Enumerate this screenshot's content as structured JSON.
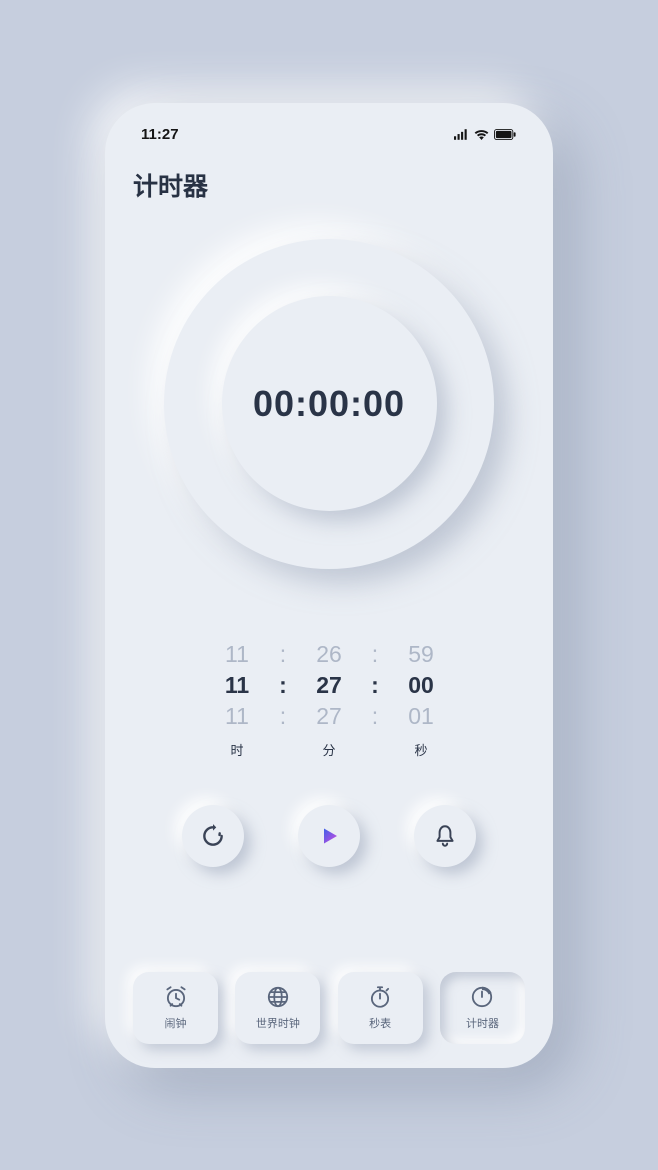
{
  "status_bar": {
    "time": "11:27"
  },
  "page": {
    "title": "计时器"
  },
  "timer": {
    "display": "00:00:00"
  },
  "picker": {
    "rows": [
      {
        "h": "11",
        "m": "26",
        "s": "59"
      },
      {
        "h": "11",
        "m": "27",
        "s": "00"
      },
      {
        "h": "11",
        "m": "27",
        "s": "01"
      }
    ],
    "labels": {
      "h": "时",
      "m": "分",
      "s": "秒"
    },
    "sep": ":"
  },
  "controls": {
    "refresh": "refresh-icon",
    "play": "play-icon",
    "bell": "bell-icon"
  },
  "nav": {
    "items": [
      {
        "id": "alarm",
        "label": "闹钟",
        "active": false
      },
      {
        "id": "worldclock",
        "label": "世界时钟",
        "active": false
      },
      {
        "id": "stopwatch",
        "label": "秒表",
        "active": false
      },
      {
        "id": "timer",
        "label": "计时器",
        "active": true
      }
    ]
  },
  "colors": {
    "bg": "#c6cede",
    "surface": "#eaeef4",
    "text_dark": "#2a3447",
    "text_fade": "#aeb7c7",
    "icon": "#5a667c",
    "play_grad_a": "#3e60e8",
    "play_grad_b": "#d14be0"
  }
}
